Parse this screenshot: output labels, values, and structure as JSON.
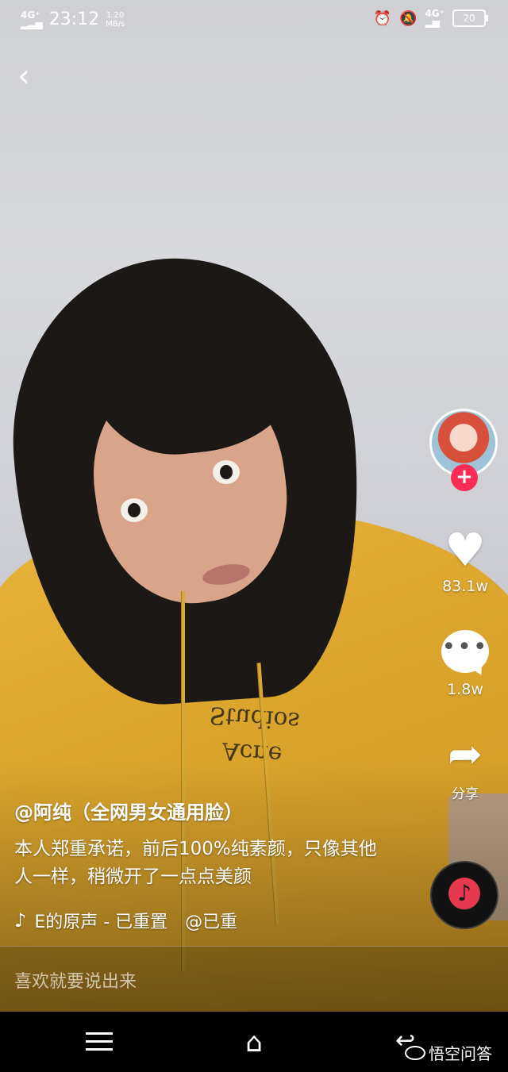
{
  "status_bar": {
    "signal_left": "4G⁺",
    "time": "23:12",
    "net_speed_value": "1.20",
    "net_speed_unit": "MB/s",
    "signal_right": "4G⁺",
    "battery": "20"
  },
  "video": {
    "print_text_line1": "Acne",
    "print_text_line2": "Studios"
  },
  "rail": {
    "likes": "83.1w",
    "comments": "1.8w",
    "share_label": "分享",
    "follow_symbol": "+",
    "comment_dots": "•••",
    "music_note": "♪"
  },
  "caption": {
    "author": "@阿纯（全网男女通用脸）",
    "description": "本人郑重承诺，前后100%纯素颜，只像其他人一样，稍微开了一点点美颜",
    "music": "E的原声 - 已重置　@已重"
  },
  "comment_bar": {
    "placeholder": "喜欢就要说出来"
  },
  "watermark": {
    "text": "悟空问答"
  },
  "icons": {
    "back": "back-chevron-icon",
    "like": "heart-icon",
    "comment": "comment-bubble-icon",
    "share": "share-arrow-icon",
    "music": "tiktok-note-icon",
    "menu": "menu-icon",
    "home": "home-icon",
    "nav_back": "nav-back-icon",
    "alarm": "alarm-icon",
    "mute": "bell-muted-icon"
  }
}
